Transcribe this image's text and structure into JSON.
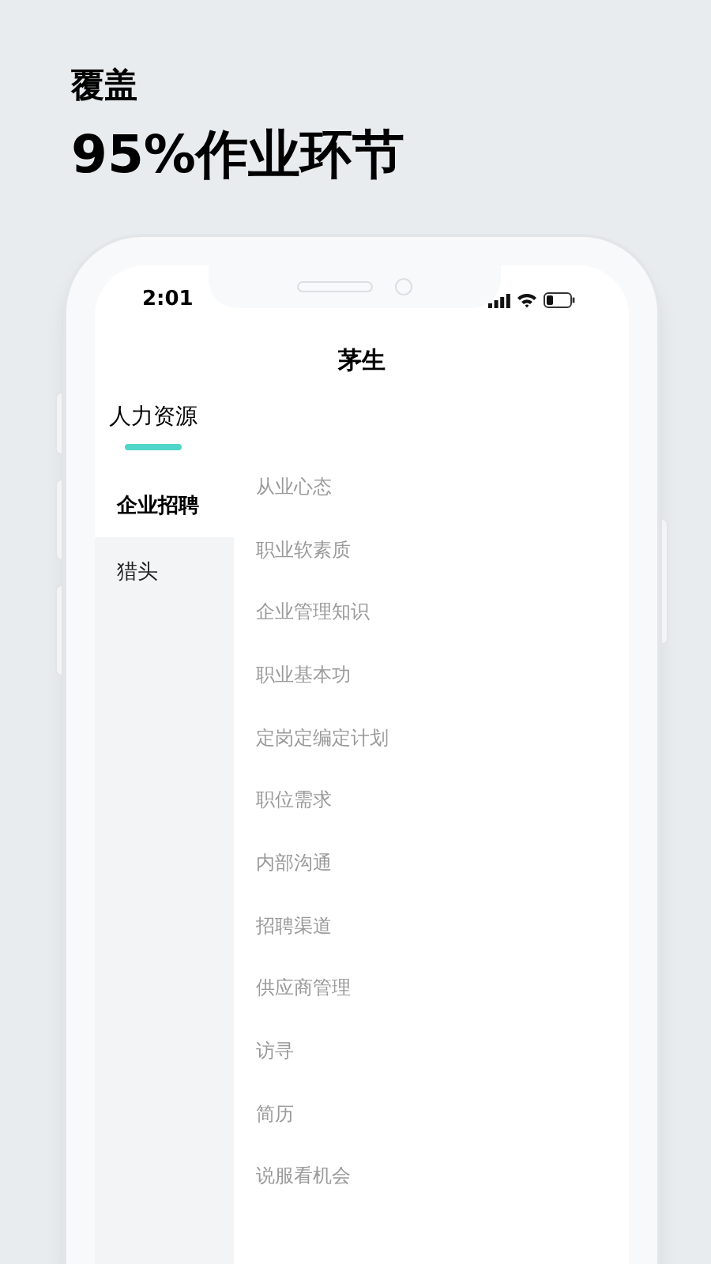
{
  "headline": {
    "subtitle": "覆盖",
    "title": "95%作业环节"
  },
  "status_bar": {
    "time": "2:01"
  },
  "title": "茅生",
  "tabs": [
    {
      "label": "人力资源",
      "selected": true
    }
  ],
  "sidebar": {
    "items": [
      {
        "label": "企业招聘",
        "selected": true
      },
      {
        "label": "猎头",
        "selected": false
      }
    ]
  },
  "topics": [
    "从业心态",
    "职业软素质",
    "企业管理知识",
    "职业基本功",
    "定岗定编定计划",
    "职位需求",
    "内部沟通",
    "招聘渠道",
    "供应商管理",
    "访寻",
    "简历",
    "说服看机会"
  ]
}
